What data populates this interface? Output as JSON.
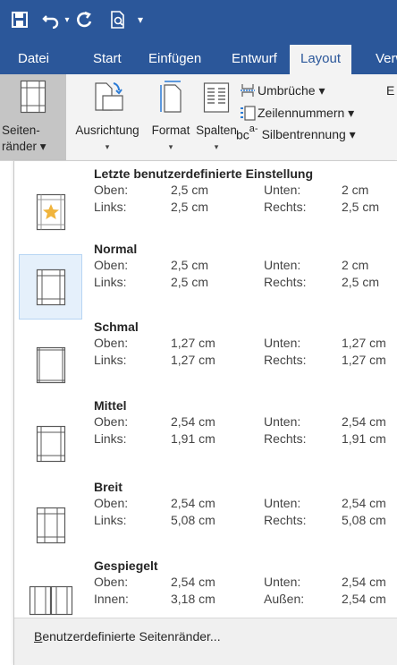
{
  "qat": {
    "save": "save-icon",
    "undo": "undo-icon",
    "undo_dropdown": "▾",
    "redo": "redo-icon",
    "print_preview": "print-preview-icon",
    "customize": "▾"
  },
  "tabs": [
    {
      "label": "Datei"
    },
    {
      "label": "Start"
    },
    {
      "label": "Einfügen"
    },
    {
      "label": "Entwurf"
    },
    {
      "label": "Layout",
      "active": true
    },
    {
      "label": "Verw"
    }
  ],
  "ribbon": {
    "margins": {
      "line1": "Seiten-",
      "line2": "ränder ▾"
    },
    "orientation": {
      "label": "Ausrichtung",
      "chevron": "▾"
    },
    "size": {
      "label": "Format",
      "chevron": "▾"
    },
    "columns": {
      "label": "Spalten",
      "chevron": "▾"
    },
    "breaks": "Umbrüche ▾",
    "line_numbers": "Zeilennummern ▾",
    "hyphenation": "Silbentrennung ▾",
    "hyphenation_glyph": "bc",
    "hyphenation_sup": "a-",
    "cut_label": "E"
  },
  "margin_options": [
    {
      "title": "Letzte benutzerdefinierte Einstellung",
      "row1": {
        "k1": "Oben:",
        "v1": "2,5 cm",
        "k2": "Unten:",
        "v2": "2 cm"
      },
      "row2": {
        "k1": "Links:",
        "v1": "2,5 cm",
        "k2": "Rechts:",
        "v2": "2,5 cm"
      },
      "icon": "custom-star-icon"
    },
    {
      "title": "Normal",
      "row1": {
        "k1": "Oben:",
        "v1": "2,5 cm",
        "k2": "Unten:",
        "v2": "2 cm"
      },
      "row2": {
        "k1": "Links:",
        "v1": "2,5 cm",
        "k2": "Rechts:",
        "v2": "2,5 cm"
      },
      "icon": "margin-normal-icon",
      "selected": true
    },
    {
      "title": "Schmal",
      "row1": {
        "k1": "Oben:",
        "v1": "1,27 cm",
        "k2": "Unten:",
        "v2": "1,27 cm"
      },
      "row2": {
        "k1": "Links:",
        "v1": "1,27 cm",
        "k2": "Rechts:",
        "v2": "1,27 cm"
      },
      "icon": "margin-narrow-icon"
    },
    {
      "title": "Mittel",
      "row1": {
        "k1": "Oben:",
        "v1": "2,54 cm",
        "k2": "Unten:",
        "v2": "2,54 cm"
      },
      "row2": {
        "k1": "Links:",
        "v1": "1,91 cm",
        "k2": "Rechts:",
        "v2": "1,91 cm"
      },
      "icon": "margin-moderate-icon"
    },
    {
      "title": "Breit",
      "row1": {
        "k1": "Oben:",
        "v1": "2,54 cm",
        "k2": "Unten:",
        "v2": "2,54 cm"
      },
      "row2": {
        "k1": "Links:",
        "v1": "5,08 cm",
        "k2": "Rechts:",
        "v2": "5,08 cm"
      },
      "icon": "margin-wide-icon"
    },
    {
      "title": "Gespiegelt",
      "row1": {
        "k1": "Oben:",
        "v1": "2,54 cm",
        "k2": "Unten:",
        "v2": "2,54 cm"
      },
      "row2": {
        "k1": "Innen:",
        "v1": "3,18 cm",
        "k2": "Außen:",
        "v2": "2,54 cm"
      },
      "icon": "margin-mirrored-icon"
    }
  ],
  "footer": {
    "accel": "B",
    "rest": "enutzerdefinierte Seitenränder..."
  },
  "colors": {
    "accent": "#2b579a",
    "selected_bg": "#e5f0fb",
    "star": "#f0b43c"
  }
}
